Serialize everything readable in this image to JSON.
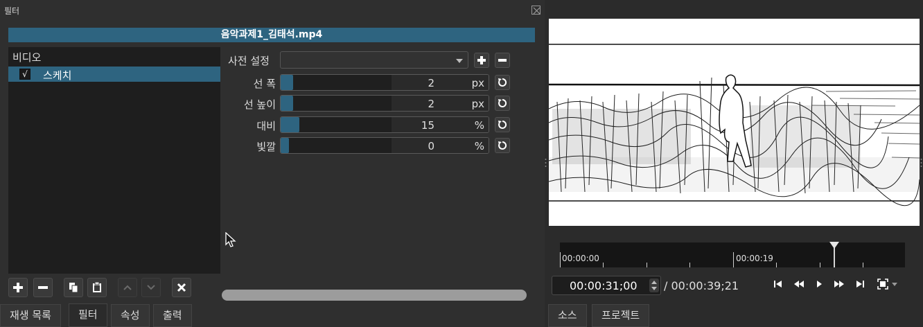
{
  "filter_panel": {
    "title": "필터",
    "clip_name": "음악과제1_김태석.mp4",
    "group_label": "비디오",
    "filters": [
      {
        "name": "스케치",
        "checked": true,
        "check_mark": "√"
      }
    ],
    "preset": {
      "label": "사전 설정",
      "value": ""
    },
    "params": [
      {
        "label": "선 폭",
        "value": "2",
        "unit": "px",
        "level": 0.02
      },
      {
        "label": "선 높이",
        "value": "2",
        "unit": "px",
        "level": 0.02
      },
      {
        "label": "대비",
        "value": "15",
        "unit": "%",
        "level": 0.05
      },
      {
        "label": "빛깔",
        "value": "0",
        "unit": "%",
        "level": 0.0
      }
    ],
    "toolbar_icons": [
      "add-icon",
      "remove-icon",
      "copy-icon",
      "paste-icon",
      "move-up-icon",
      "move-down-icon",
      "deselect-icon"
    ],
    "tabs": [
      "재생 목록",
      "필터",
      "속성",
      "출력"
    ],
    "active_tab": "필터"
  },
  "player": {
    "timeline": {
      "labels": [
        "00:00:00",
        "00:00:19"
      ]
    },
    "timecode": "00:00:31;00",
    "duration": "/ 00:00:39;21",
    "playhead_position": 0.795,
    "transport_icons": [
      "skip-to-start-icon",
      "rewind-icon",
      "play-icon",
      "fast-forward-icon",
      "skip-to-end-icon",
      "zoom-fit-icon"
    ],
    "tabs": [
      "소스",
      "프로젝트"
    ]
  },
  "colors": {
    "accent": "#2e6480",
    "background": "#2b2b2b",
    "list_background": "#1e1e1e"
  }
}
